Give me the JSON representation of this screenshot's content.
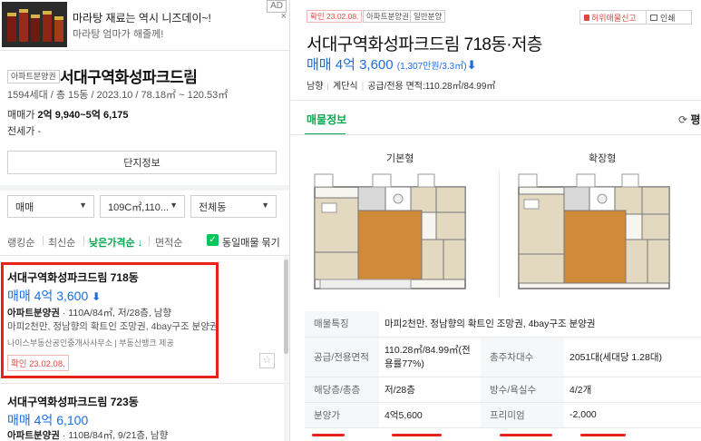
{
  "ad": {
    "title": "마라탕 재료는 역시 니즈데이~!",
    "subtitle": "마라탕 엄마가 해줄께!",
    "badge": "AD",
    "close": "×"
  },
  "complex": {
    "badge": "아파트분양권",
    "name": "서대구역화성파크드림",
    "star": "☆",
    "meta": "1594세대 / 총 15동 / 2023.10 / 78.18㎡ ~ 120.53㎡",
    "price_label": "매매가",
    "price_value": "2억 9,940~5억 6,175",
    "rent_label": "전세가 -",
    "info_button": "단지정보"
  },
  "filters": {
    "trade": "매매",
    "area": "109C㎡,110...",
    "dong": "전체동"
  },
  "sort": {
    "items": [
      "랭킹순",
      "최신순",
      "낮은가격순 ↓",
      "면적순"
    ],
    "same_listing_label": "동일매물 묶기",
    "check": "✓"
  },
  "listings": [
    {
      "title": "서대구역화성파크드림 718동",
      "price": "매매 4억 3,600",
      "arrow": "⬇",
      "spec_bold": "아파트분양권",
      "spec_rest": " · 110A/84㎡, 저/28층, 남향",
      "desc": "마피2천만, 정남향의 확트인 조망권, 4bay구조 분양권",
      "agent": "나이스부동산공인중개사사무소  |  부동산뱅크 제공",
      "confirm": "확인 23.02.08.",
      "fav": "☆"
    },
    {
      "title": "서대구역화성파크드림 723동",
      "price": "매매 4억 6,100",
      "spec_bold": "아파트분양권",
      "spec_rest": " · 110B/84㎡, 9/21층, 남향"
    }
  ],
  "detail": {
    "tags": [
      "확인 23.02.08.",
      "아파트분양권",
      "일반분양"
    ],
    "report": "허위매물신고",
    "print": "인쇄",
    "title": "서대구역화성파크드림 718동·저층",
    "price": "매매 4억 3,600",
    "price_per": "(1,307만원/3.3㎡)",
    "arrow": "⬇",
    "meta": [
      "남향",
      "계단식",
      "공급/전용 면적:110.28㎡/84.99㎡"
    ],
    "tab_active": "매물정보",
    "tab_right": "평",
    "tab_right_icon": "⟳",
    "floorplans": [
      "기본형",
      "확장형"
    ],
    "table": [
      {
        "h1": "매물특징",
        "v1": "마피2천만, 정남향의 확트인 조망권, 4bay구조 분양권"
      },
      {
        "h1": "공급/전용면적",
        "v1": "110.28㎡/84.99㎡(전용률77%)",
        "h2": "총주차대수",
        "v2": "2051대(세대당 1.28대)"
      },
      {
        "h1": "해당층/총층",
        "v1": "저/28층",
        "h2": "방수/욕실수",
        "v2": "4/2개"
      },
      {
        "h1": "분양가",
        "v1": "4억5,600",
        "h2": "프리미엄",
        "v2": "-2,000"
      }
    ]
  },
  "colors": {
    "accent_green": "#03a94f",
    "price_blue": "#1b6de0",
    "highlight_red": "#e8211d"
  }
}
